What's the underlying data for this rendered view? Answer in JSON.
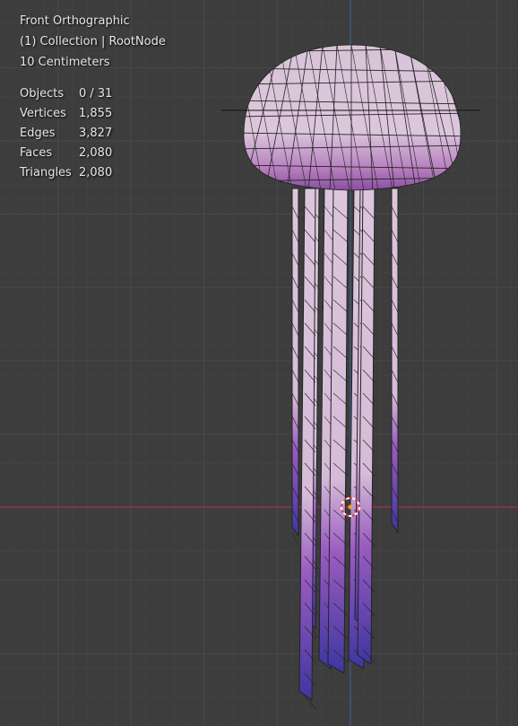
{
  "viewport": {
    "view_name": "Front Orthographic",
    "collection": "(1) Collection | RootNode",
    "scale": "10 Centimeters",
    "colors": {
      "background": "#3d3d3d",
      "x_axis": "#9c3a44",
      "z_axis": "#3b5f8f",
      "mesh_top": "#d9c2d9",
      "mesh_bottom": "#4a3a9a"
    }
  },
  "stats": [
    {
      "label": "Objects",
      "value": "0 / 31"
    },
    {
      "label": "Vertices",
      "value": "1,855"
    },
    {
      "label": "Edges",
      "value": "3,827"
    },
    {
      "label": "Faces",
      "value": "2,080"
    },
    {
      "label": "Triangles",
      "value": "2,080"
    }
  ]
}
